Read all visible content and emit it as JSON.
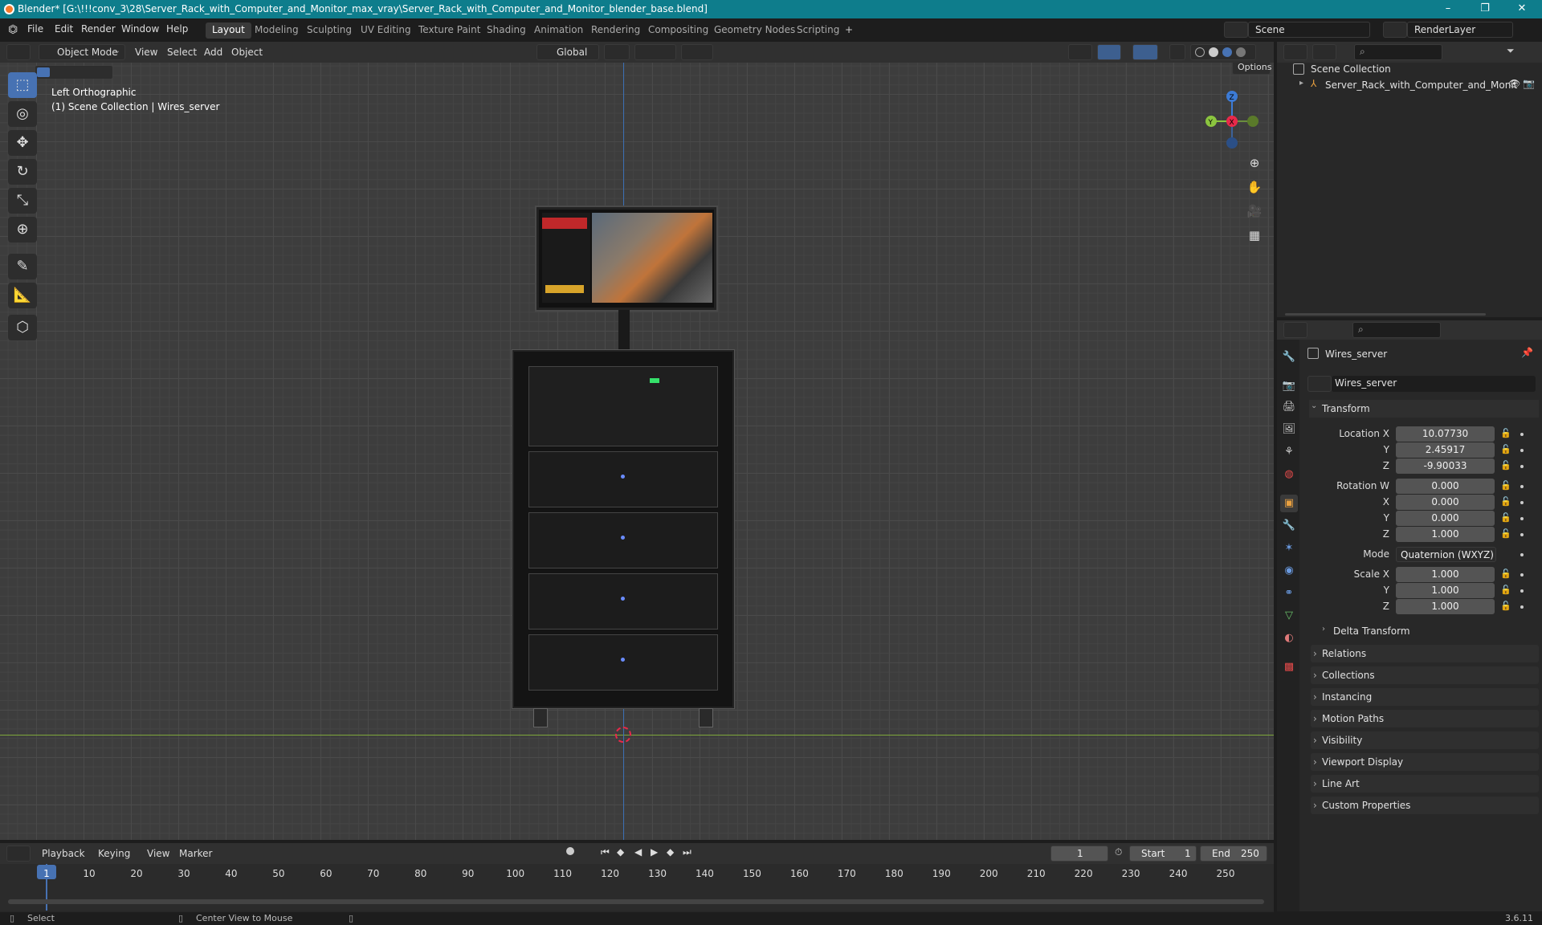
{
  "window": {
    "title": "Blender* [G:\\!!!conv_3\\28\\Server_Rack_with_Computer_and_Monitor_max_vray\\Server_Rack_with_Computer_and_Monitor_blender_base.blend]",
    "minimize": "–",
    "maximize": "❐",
    "close": "✕"
  },
  "menu": [
    "File",
    "Edit",
    "Render",
    "Window",
    "Help"
  ],
  "workspaces": [
    "Layout",
    "Modeling",
    "Sculpting",
    "UV Editing",
    "Texture Paint",
    "Shading",
    "Animation",
    "Rendering",
    "Compositing",
    "Geometry Nodes",
    "Scripting"
  ],
  "active_workspace": "Layout",
  "add_workspace": "+",
  "scene": {
    "label": "Scene",
    "render_layer": "RenderLayer"
  },
  "viewport_header": {
    "mode": "Object Mode",
    "menus": [
      "View",
      "Select",
      "Add",
      "Object"
    ],
    "orientation": "Global",
    "options": "Options"
  },
  "viewport": {
    "view_name": "Left Orthographic",
    "collection_info": "(1) Scene Collection | Wires_server",
    "gizmo": {
      "z": "Z",
      "y": "Y",
      "x": "X"
    }
  },
  "outliner": {
    "root": "Scene Collection",
    "items": [
      {
        "label": "Server_Rack_with_Computer_and_Monit"
      }
    ]
  },
  "properties": {
    "object_name": "Wires_server",
    "data_name": "Wires_server",
    "transform_label": "Transform",
    "location": {
      "label": "Location X",
      "x": "10.07730",
      "y": "2.45917",
      "z": "-9.90033"
    },
    "rotation": {
      "label": "Rotation W",
      "w": "0.000",
      "x": "0.000",
      "y": "0.000",
      "z": "1.000"
    },
    "mode": {
      "label": "Mode",
      "value": "Quaternion (WXYZ)"
    },
    "scale": {
      "label": "Scale X",
      "x": "1.000",
      "y": "1.000",
      "z": "1.000"
    },
    "axis_labels": {
      "x": "X",
      "y": "Y",
      "z": "Z"
    },
    "delta_transform": "Delta Transform",
    "sections": [
      "Relations",
      "Collections",
      "Instancing",
      "Motion Paths",
      "Visibility",
      "Viewport Display",
      "Line Art",
      "Custom Properties"
    ]
  },
  "timeline": {
    "menus": [
      "Playback",
      "Keying",
      "View",
      "Marker"
    ],
    "current_frame": "1",
    "start_label": "Start",
    "start": "1",
    "end_label": "End",
    "end": "250",
    "ticks": [
      "1",
      "10",
      "20",
      "30",
      "40",
      "50",
      "60",
      "70",
      "80",
      "90",
      "100",
      "110",
      "120",
      "130",
      "140",
      "150",
      "160",
      "170",
      "180",
      "190",
      "200",
      "210",
      "220",
      "230",
      "240",
      "250"
    ]
  },
  "status": {
    "select": "Select",
    "center_view": "Center View to Mouse",
    "version": "3.6.11"
  },
  "colors": {
    "accent": "#4772b3",
    "titlebar": "#0e7d8c",
    "x_axis": "#e8294a",
    "y_axis": "#8bc53f",
    "z_axis": "#3c7bd6"
  }
}
